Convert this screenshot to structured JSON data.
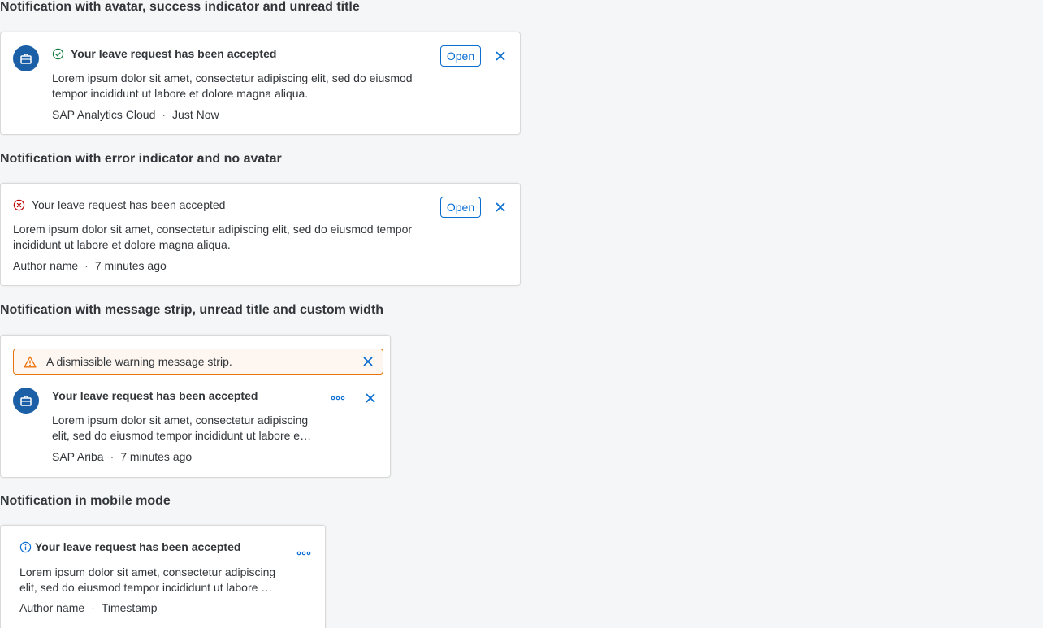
{
  "sections": [
    {
      "heading": "Notification with avatar, success indicator and unread title",
      "title": "Your leave request has been accepted",
      "body": "Lorem ipsum dolor sit amet, consectetur adipiscing elit, sed do eiusmod tempor incididunt ut labore et dolore magna aliqua.",
      "author": "SAP Analytics Cloud",
      "separator": "·",
      "timestamp": "Just Now",
      "open_label": "Open",
      "indicator": "success-icon",
      "avatar_icon": "briefcase-icon"
    },
    {
      "heading": "Notification with error indicator and no avatar",
      "title": "Your leave request has been accepted",
      "body": "Lorem ipsum dolor sit amet, consectetur adipiscing elit, sed do eiusmod tempor incididunt ut labore et dolore magna aliqua.",
      "author": "Author name",
      "separator": "·",
      "timestamp": "7 minutes ago",
      "open_label": "Open",
      "indicator": "error-icon"
    },
    {
      "heading": "Notification with message strip, unread title and custom width",
      "strip_text": "A dismissible warning message strip.",
      "title": "Your leave request has been accepted",
      "body": "Lorem ipsum dolor sit amet, consectetur adipiscing elit, sed do eiusmod tempor incididunt ut labore et dolore magna aliqua.",
      "author": "SAP Ariba",
      "separator": "·",
      "timestamp": "7 minutes ago",
      "indicator": "warning-icon",
      "avatar_icon": "briefcase-icon"
    },
    {
      "heading": "Notification in mobile mode",
      "title": "Your leave request has been accepted",
      "body": "Lorem ipsum dolor sit amet, consectetur adipiscing elit, sed do eiusmod tempor incididunt ut labore et dolore magna aliqua.",
      "author": "Author name",
      "separator": "·",
      "timestamp": "Timestamp",
      "indicator": "information-icon"
    }
  ],
  "colors": {
    "brand_blue": "#0a6ed1",
    "avatar_blue": "#1b5fa6",
    "success": "#107e3e",
    "error": "#bb0000",
    "warning": "#e9730c",
    "information": "#0a6ed1"
  }
}
